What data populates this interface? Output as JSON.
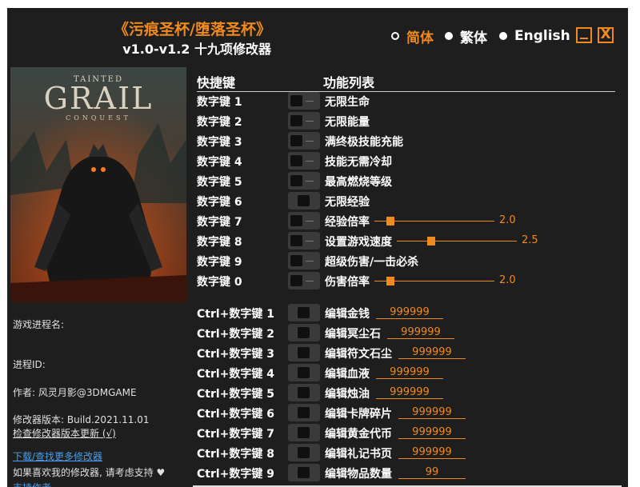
{
  "header": {
    "title": "《污痕圣杯/堕落圣杯》",
    "subtitle": "v1.0-v1.2 十九项修改器"
  },
  "languages": {
    "simplified": "简体",
    "traditional": "繁体",
    "english": "English",
    "selected": "简体"
  },
  "window_controls": {
    "close_label": "X"
  },
  "cover": {
    "logo_line1": "TAINTED",
    "logo_line2": "GRAIL",
    "logo_line3": "CONQUEST"
  },
  "sidebar": {
    "process_name_label": "游戏进程名:",
    "process_id_label": "进程ID:",
    "author": "作者: 风灵月影@3DMGAME",
    "version": "修改器版本: Build.2021.11.01",
    "check_update": "检查修改器版本更新 (√)",
    "download_more": "下载/查找更多修改器",
    "support_text": "如果喜欢我的修改器, 请考虑支持 ♥",
    "support_link": "支持作者"
  },
  "columns": {
    "hotkey": "快捷键",
    "features": "功能列表"
  },
  "numpad_rows": [
    {
      "key": "数字键 1",
      "label": "无限生命",
      "alt": false
    },
    {
      "key": "数字键 2",
      "label": "无限能量",
      "alt": false
    },
    {
      "key": "数字键 3",
      "label": "满终极技能充能",
      "alt": false
    },
    {
      "key": "数字键 4",
      "label": "技能无需冷却",
      "alt": false
    },
    {
      "key": "数字键 5",
      "label": "最高燃烧等级",
      "alt": false
    },
    {
      "key": "数字键 6",
      "label": "无限经验",
      "alt": true
    },
    {
      "key": "数字键 7",
      "label": "经验倍率",
      "alt": false,
      "slider": {
        "value": "2.0",
        "fraction": 0.1
      }
    },
    {
      "key": "数字键 8",
      "label": "设置游戏速度",
      "alt": false,
      "slider": {
        "value": "2.5",
        "fraction": 0.25
      }
    },
    {
      "key": "数字键 9",
      "label": "超级伤害/一击必杀",
      "alt": false
    },
    {
      "key": "数字键 0",
      "label": "伤害倍率",
      "alt": false,
      "slider": {
        "value": "2.0",
        "fraction": 0.1
      }
    }
  ],
  "ctrl_rows": [
    {
      "key": "Ctrl+数字键 1",
      "label": "编辑金钱",
      "value": "999999"
    },
    {
      "key": "Ctrl+数字键 2",
      "label": "编辑冥尘石",
      "value": "999999"
    },
    {
      "key": "Ctrl+数字键 3",
      "label": "编辑符文石尘",
      "value": "999999"
    },
    {
      "key": "Ctrl+数字键 4",
      "label": "编辑血液",
      "value": "999999"
    },
    {
      "key": "Ctrl+数字键 5",
      "label": "编辑烛油",
      "value": "999999"
    },
    {
      "key": "Ctrl+数字键 6",
      "label": "编辑卡牌碎片",
      "value": "999999"
    },
    {
      "key": "Ctrl+数字键 7",
      "label": "编辑黄金代币",
      "value": "999999"
    },
    {
      "key": "Ctrl+数字键 8",
      "label": "编辑礼记书页",
      "value": "999999"
    },
    {
      "key": "Ctrl+数字键 9",
      "label": "编辑物品数量",
      "value": "99"
    }
  ],
  "colors": {
    "accent": "#f08a1e",
    "background": "#1e1e1e",
    "link": "#4a9fe8"
  }
}
